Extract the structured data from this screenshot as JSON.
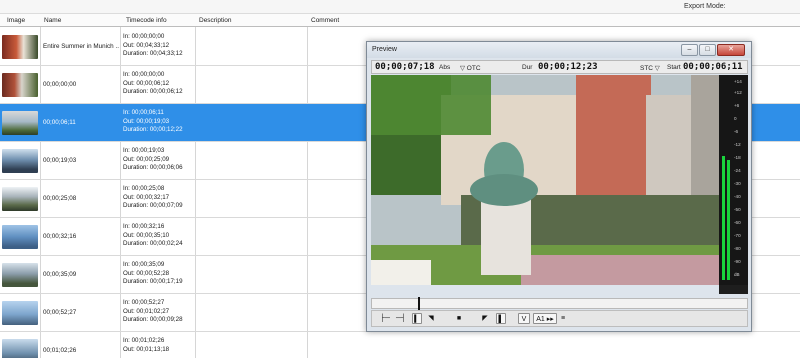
{
  "header": {
    "export_mode_label": "Export Mode:"
  },
  "table": {
    "columns": [
      "Image",
      "Name",
      "Timecode info",
      "Description",
      "Comment"
    ],
    "rows": [
      {
        "name": "Entire Summer in Munich ...",
        "in": "In: 00;00;00;00",
        "out": "Out: 00;04;33;12",
        "duration": "Duration: 00;04;33;12",
        "selected": false
      },
      {
        "name": "00;00;00;00",
        "in": "In: 00;00;00;00",
        "out": "Out: 00;00;06;12",
        "duration": "Duration: 00;00;06;12",
        "selected": false
      },
      {
        "name": "00;00;06;11",
        "in": "In: 00;00;06;11",
        "out": "Out: 00;00;19;03",
        "duration": "Duration: 00;00;12;22",
        "selected": true
      },
      {
        "name": "00;00;19;03",
        "in": "In: 00;00;19;03",
        "out": "Out: 00;00;25;09",
        "duration": "Duration: 00;00;06;06",
        "selected": false
      },
      {
        "name": "00;00;25;08",
        "in": "In: 00;00;25;08",
        "out": "Out: 00;00;32;17",
        "duration": "Duration: 00;00;07;09",
        "selected": false
      },
      {
        "name": "00;00;32;16",
        "in": "In: 00;00;32;16",
        "out": "Out: 00;00;35;10",
        "duration": "Duration: 00;00;02;24",
        "selected": false
      },
      {
        "name": "00;00;35;09",
        "in": "In: 00;00;35;09",
        "out": "Out: 00;00;52;28",
        "duration": "Duration: 00;00;17;19",
        "selected": false
      },
      {
        "name": "00;00;52;27",
        "in": "In: 00;00;52;27",
        "out": "Out: 00;01;02;27",
        "duration": "Duration: 00;00;09;28",
        "selected": false
      },
      {
        "name": "00;01;02;26",
        "in": "In: 00;01;02;26",
        "out": "Out: 00;01;13;18",
        "duration": "",
        "selected": false
      }
    ]
  },
  "preview": {
    "title": "Preview",
    "window_buttons": {
      "minimize": "–",
      "maximize": "□",
      "close": "✕"
    },
    "current_timecode": "00;00;07;18",
    "abs_label": "Abs",
    "otc_label": "▽ OTC",
    "dur_label": "Dur",
    "duration_timecode": "00;00;12;23",
    "stc_label": "STC ▽",
    "start_label": "Start",
    "start_timecode": "00;00;06;11",
    "meter_labels": [
      "+14",
      "+12",
      "+6",
      "0",
      "-6",
      "-12",
      "-18",
      "-24",
      "-30",
      "-40",
      "-50",
      "-60",
      "-70",
      "-80",
      "-90",
      "dB"
    ],
    "meter_levels": [
      0.62,
      0.6
    ],
    "controls": {
      "set_in_icon": "├─",
      "set_out_icon": "─┤",
      "mark_in_icon": "▍",
      "mark_in_small_icon": "◥",
      "stop_icon": "■",
      "mark_out_small_icon": "◤",
      "mark_out_icon": "▌",
      "video_track_label": "V",
      "audio_track_label": "A1 ▸▸",
      "menu_icon": "≡"
    }
  },
  "colors": {
    "selection": "#2f8fe8",
    "meter_green": "#19d43c"
  }
}
